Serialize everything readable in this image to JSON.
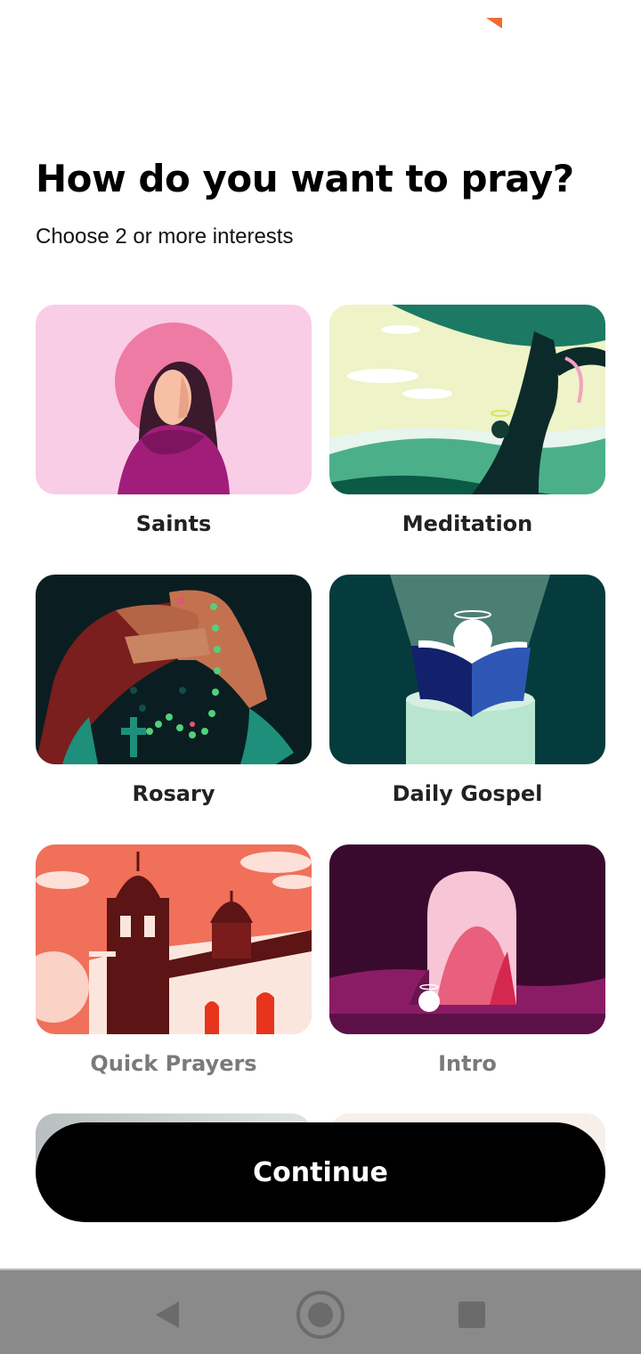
{
  "header": {
    "title": "How do you want to pray?",
    "subtitle": "Choose 2 or more interests"
  },
  "interests": [
    {
      "label": "Saints",
      "selected": false
    },
    {
      "label": "Meditation",
      "selected": false
    },
    {
      "label": "Rosary",
      "selected": false
    },
    {
      "label": "Daily Gospel",
      "selected": false
    },
    {
      "label": "Quick Prayers",
      "selected": false
    },
    {
      "label": "Intro",
      "selected": false
    }
  ],
  "footer": {
    "continue_label": "Continue"
  },
  "colors": {
    "accent": "#f26a36",
    "button_bg": "#000000",
    "navbar_bg": "#8a8a8a"
  },
  "system_nav": {
    "icons": [
      "back-icon",
      "home-icon",
      "recents-icon"
    ]
  }
}
